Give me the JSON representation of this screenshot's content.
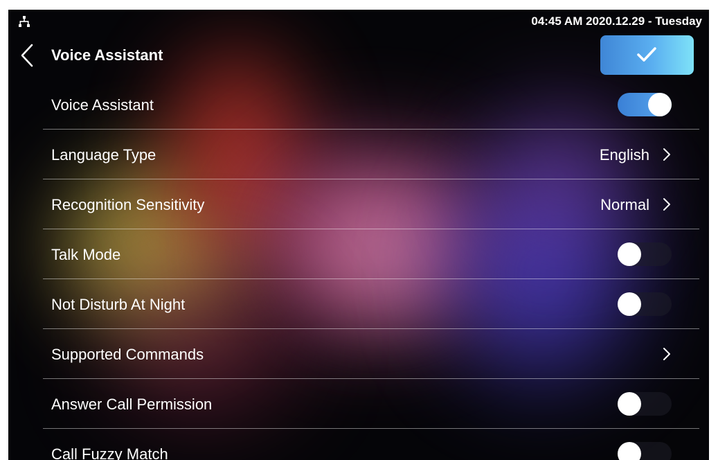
{
  "status_bar": {
    "datetime": "04:45 AM  2020.12.29 - Tuesday"
  },
  "header": {
    "title": "Voice Assistant",
    "confirm_icon": "check-icon",
    "back_icon": "chevron-left-icon"
  },
  "settings": [
    {
      "label": "Voice Assistant",
      "control": "toggle",
      "on": true
    },
    {
      "label": "Language Type",
      "control": "select",
      "value": "English"
    },
    {
      "label": "Recognition Sensitivity",
      "control": "select",
      "value": "Normal"
    },
    {
      "label": "Talk Mode",
      "control": "toggle",
      "on": false
    },
    {
      "label": "Not Disturb At Night",
      "control": "toggle",
      "on": false
    },
    {
      "label": "Supported Commands",
      "control": "link",
      "value": ""
    },
    {
      "label": "Answer Call Permission",
      "control": "toggle",
      "on": false
    },
    {
      "label": "Call Fuzzy Match",
      "control": "toggle",
      "on": false
    }
  ],
  "colors": {
    "accent": "#3f86d6",
    "accent_light": "#7ee2f8",
    "background": "#050508"
  }
}
